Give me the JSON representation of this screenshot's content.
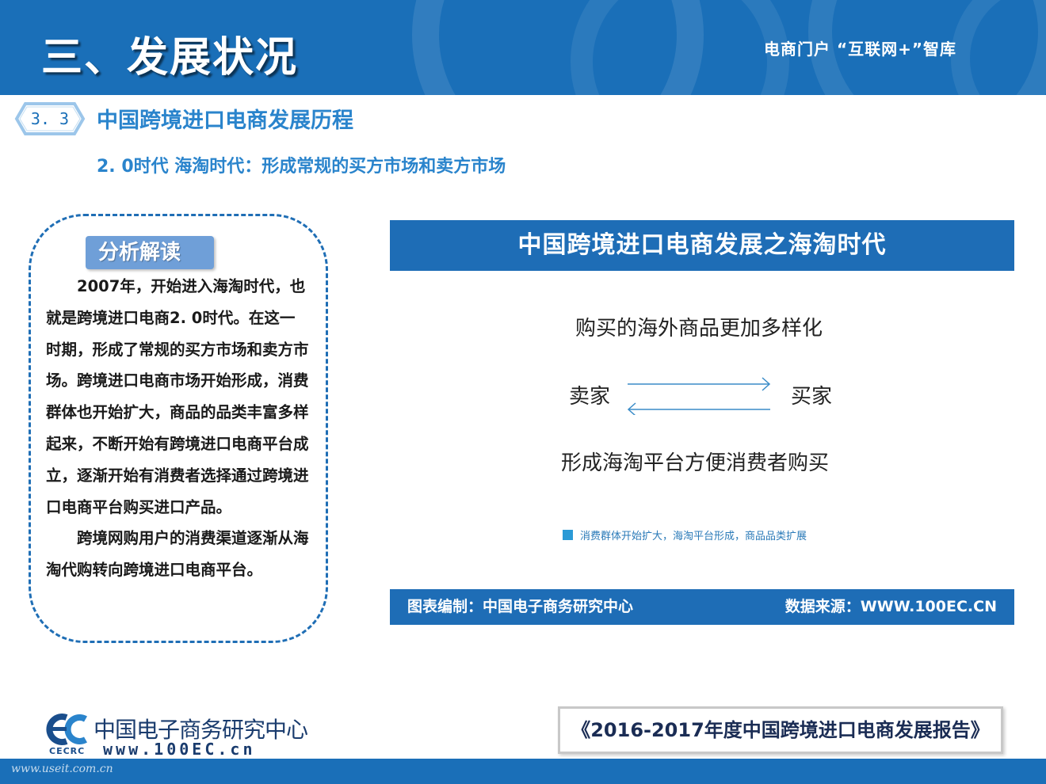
{
  "header": {
    "title": "三、发展状况",
    "right_text": "电商门户 “互联网+”智库"
  },
  "section": {
    "number": "3. 3",
    "title": "中国跨境进口电商发展历程",
    "subtitle": "2. 0时代 海淘时代：形成常规的买方市场和卖方市场"
  },
  "analysis": {
    "label": "分析解读",
    "paragraph1": "2007年，开始进入海淘时代，也就是跨境进口电商2. 0时代。在这一时期，形成了常规的买方市场和卖方市场。跨境进口电商市场开始形成，消费群体也开始扩大，商品的品类丰富多样起来，不断开始有跨境进口电商平台成立，逐渐开始有消费者选择通过跨境进口电商平台购买进口产品。",
    "paragraph2": "跨境网购用户的消费渠道逐渐从海淘代购转向跨境进口电商平台。"
  },
  "panel": {
    "title": "中国跨境进口电商发展之海淘时代",
    "line_top": "购买的海外商品更加多样化",
    "seller": "卖家",
    "buyer": "买家",
    "line_bottom": "形成海淘平台方便消费者购买",
    "legend": "消费群体开始扩大，海淘平台形成，商品品类扩展",
    "footer_left": "图表编制：中国电子商务研究中心",
    "footer_right": "数据来源：WWW.100EC.CN"
  },
  "logo": {
    "name": "中国电子商务研究中心",
    "abbr": "CECRC",
    "url": "www.100EC.cn"
  },
  "report": {
    "title": "《2016-2017年度中国跨境进口电商发展报告》"
  },
  "watermark": "www.useit.com.cn",
  "colors": {
    "brand_blue": "#1a6fb8",
    "accent_blue": "#2a84cc",
    "label_blue": "#6f9fd8"
  }
}
